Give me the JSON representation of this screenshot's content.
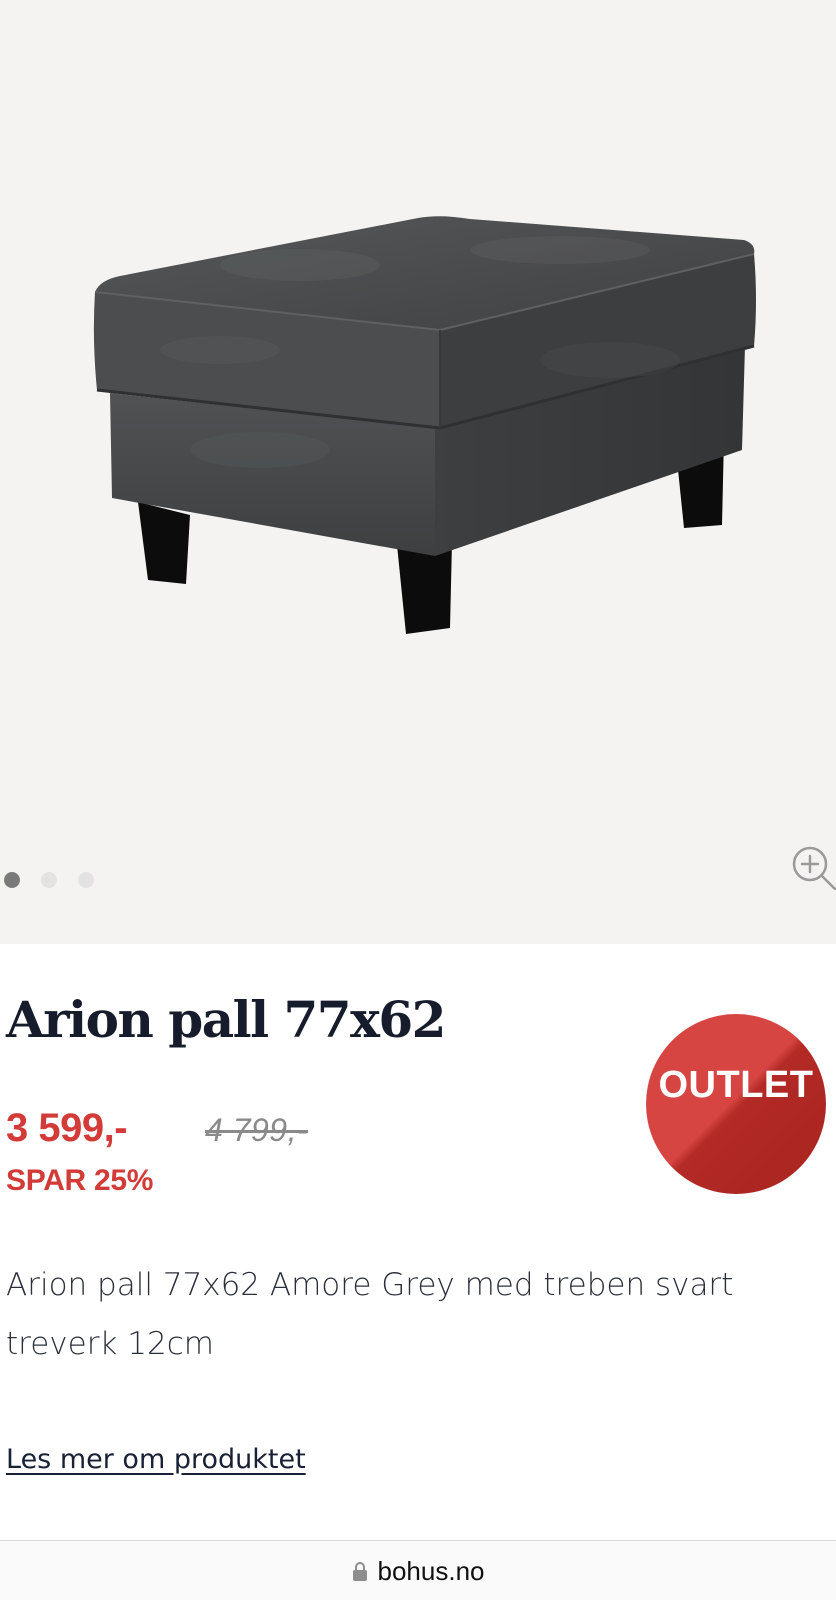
{
  "gallery": {
    "image_alt": "Arion pall 77x62 Amore Grey",
    "slide_count": 3,
    "active_slide": 1,
    "zoom_icon": "zoom-in-icon"
  },
  "product": {
    "title": "Arion pall 77x62",
    "badge": "OUTLET",
    "price_now": "3 599,-",
    "price_old": "4 799,-",
    "saving": "SPAR 25%",
    "description": "Arion pall 77x62 Amore Grey med treben svart treverk 12cm",
    "read_more": "Les mer om produktet"
  },
  "browser": {
    "url": "bohus.no",
    "lock_icon": "lock-icon"
  },
  "colors": {
    "accent_red": "#d23b37",
    "title_navy": "#161c2b",
    "gallery_bg": "#f4f3f2"
  }
}
